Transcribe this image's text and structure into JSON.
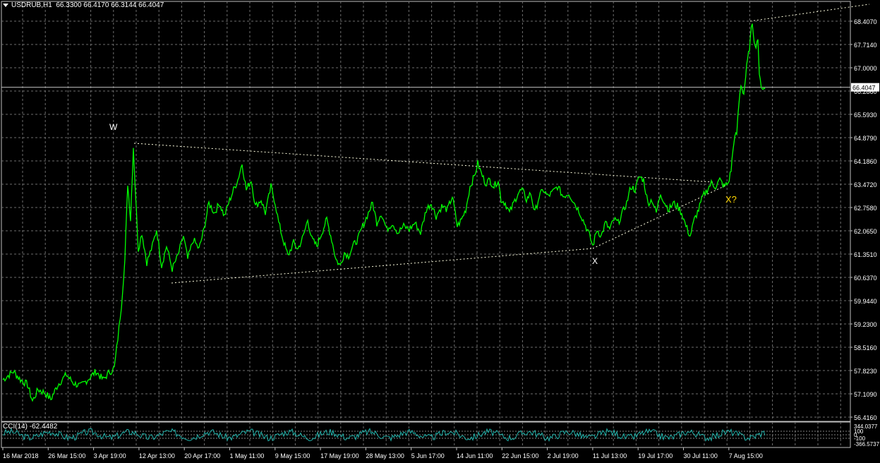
{
  "window": {
    "symbol": "USDRUB,H1",
    "ohlc": "66.3300 66.4170 66.3144 66.4047"
  },
  "colors": {
    "background": "#000000",
    "grid": "#6e6e6e",
    "price_line": "#00ff00",
    "bid_line": "#c0c0c0",
    "wave_lines": "#ffffe0",
    "cci_line": "#20b2aa",
    "text": "#ffffff",
    "label_x_question": "#ffd700"
  },
  "price_axis": {
    "ticks": [
      "68.4070",
      "67.7140",
      "67.0000",
      "66.2860",
      "65.5930",
      "64.8790",
      "64.1860",
      "63.4720",
      "62.7580",
      "62.0650",
      "61.3510",
      "60.6370",
      "59.9440",
      "59.2300",
      "58.5160",
      "57.8230",
      "57.1090",
      "56.4160"
    ],
    "current_price": "66.4047"
  },
  "cci_axis": {
    "ticks": [
      "344.0377",
      "100",
      "0",
      "-100",
      "-366.5737"
    ]
  },
  "cci": {
    "label": "CCI(14) -62.4482"
  },
  "time_axis": {
    "labels": [
      "16 Mar 2018",
      "26 Mar 15:00",
      "3 Apr 19:00",
      "12 Apr 13:00",
      "20 Apr 17:00",
      "1 May 11:00",
      "9 May 15:00",
      "17 May 19:00",
      "28 May 13:00",
      "5 Jun 17:00",
      "14 Jun 11:00",
      "22 Jun 15:00",
      "2 Jul 19:00",
      "11 Jul 13:00",
      "19 Jul 17:00",
      "30 Jul 11:00",
      "7 Aug 15:00"
    ]
  },
  "annotations": {
    "w": "W",
    "x": "X",
    "x_question": "X?"
  },
  "chart_data": {
    "type": "line",
    "title": "USDRUB,H1",
    "ylim": [
      56.416,
      68.407
    ],
    "series": [
      {
        "name": "USDRUB,H1",
        "points": [
          [
            0,
            57.55
          ],
          [
            15,
            57.8
          ],
          [
            25,
            57.55
          ],
          [
            35,
            57.4
          ],
          [
            42,
            56.9
          ],
          [
            50,
            57.25
          ],
          [
            60,
            57.15
          ],
          [
            68,
            56.95
          ],
          [
            78,
            57.4
          ],
          [
            90,
            57.7
          ],
          [
            100,
            57.45
          ],
          [
            110,
            57.35
          ],
          [
            120,
            57.55
          ],
          [
            132,
            57.8
          ],
          [
            142,
            57.55
          ],
          [
            150,
            57.75
          ],
          [
            158,
            57.9
          ],
          [
            163,
            58.8
          ],
          [
            168,
            59.8
          ],
          [
            173,
            61.2
          ],
          [
            177,
            63.5
          ],
          [
            181,
            62.4
          ],
          [
            185,
            64.6
          ],
          [
            188,
            63.2
          ],
          [
            192,
            61.5
          ],
          [
            197,
            62.0
          ],
          [
            204,
            61.1
          ],
          [
            212,
            61.6
          ],
          [
            218,
            62.1
          ],
          [
            225,
            61.0
          ],
          [
            232,
            61.6
          ],
          [
            240,
            60.9
          ],
          [
            248,
            61.3
          ],
          [
            256,
            61.9
          ],
          [
            262,
            61.2
          ],
          [
            270,
            61.8
          ],
          [
            278,
            61.5
          ],
          [
            285,
            62.1
          ],
          [
            292,
            62.9
          ],
          [
            300,
            62.6
          ],
          [
            307,
            62.9
          ],
          [
            314,
            62.5
          ],
          [
            320,
            62.9
          ],
          [
            327,
            63.3
          ],
          [
            333,
            63.6
          ],
          [
            339,
            64.1
          ],
          [
            345,
            63.3
          ],
          [
            352,
            63.6
          ],
          [
            358,
            62.8
          ],
          [
            366,
            63.0
          ],
          [
            372,
            62.6
          ],
          [
            380,
            63.4
          ],
          [
            386,
            62.9
          ],
          [
            391,
            62.3
          ],
          [
            397,
            61.8
          ],
          [
            404,
            61.3
          ],
          [
            412,
            61.7
          ],
          [
            418,
            61.5
          ],
          [
            426,
            61.9
          ],
          [
            432,
            62.4
          ],
          [
            438,
            61.8
          ],
          [
            445,
            61.6
          ],
          [
            452,
            62.0
          ],
          [
            459,
            62.4
          ],
          [
            466,
            61.8
          ],
          [
            472,
            61.2
          ],
          [
            478,
            61.0
          ],
          [
            484,
            61.4
          ],
          [
            490,
            61.3
          ],
          [
            496,
            61.6
          ],
          [
            503,
            61.8
          ],
          [
            510,
            62.2
          ],
          [
            518,
            62.6
          ],
          [
            524,
            62.9
          ],
          [
            530,
            62.3
          ],
          [
            536,
            62.6
          ],
          [
            544,
            62.1
          ],
          [
            552,
            62.3
          ],
          [
            560,
            62.0
          ],
          [
            568,
            62.2
          ],
          [
            576,
            62.1
          ],
          [
            584,
            62.3
          ],
          [
            592,
            62.0
          ],
          [
            600,
            62.7
          ],
          [
            607,
            62.9
          ],
          [
            614,
            62.5
          ],
          [
            622,
            62.8
          ],
          [
            630,
            62.7
          ],
          [
            637,
            63.1
          ],
          [
            644,
            62.2
          ],
          [
            650,
            62.4
          ],
          [
            656,
            62.7
          ],
          [
            662,
            63.4
          ],
          [
            668,
            63.7
          ],
          [
            673,
            64.1
          ],
          [
            678,
            63.8
          ],
          [
            684,
            63.5
          ],
          [
            690,
            63.6
          ],
          [
            696,
            63.4
          ],
          [
            702,
            63.6
          ],
          [
            706,
            63.0
          ],
          [
            712,
            62.9
          ],
          [
            718,
            62.6
          ],
          [
            724,
            62.9
          ],
          [
            730,
            63.2
          ],
          [
            736,
            63.3
          ],
          [
            742,
            63.0
          ],
          [
            748,
            63.2
          ],
          [
            754,
            62.6
          ],
          [
            760,
            63.1
          ],
          [
            766,
            63.3
          ],
          [
            772,
            63.1
          ],
          [
            778,
            63.2
          ],
          [
            786,
            63.4
          ],
          [
            794,
            63.1
          ],
          [
            802,
            63.2
          ],
          [
            810,
            62.9
          ],
          [
            818,
            62.6
          ],
          [
            824,
            62.3
          ],
          [
            830,
            62.0
          ],
          [
            836,
            61.6
          ],
          [
            842,
            62.1
          ],
          [
            848,
            61.9
          ],
          [
            854,
            62.3
          ],
          [
            860,
            62.1
          ],
          [
            866,
            62.4
          ],
          [
            872,
            62.3
          ],
          [
            878,
            62.6
          ],
          [
            884,
            62.9
          ],
          [
            890,
            63.4
          ],
          [
            896,
            63.3
          ],
          [
            902,
            63.7
          ],
          [
            908,
            63.6
          ],
          [
            914,
            62.9
          ],
          [
            920,
            63.0
          ],
          [
            926,
            62.6
          ],
          [
            932,
            63.2
          ],
          [
            938,
            62.9
          ],
          [
            944,
            62.7
          ],
          [
            950,
            62.9
          ],
          [
            956,
            62.8
          ],
          [
            962,
            62.6
          ],
          [
            968,
            62.2
          ],
          [
            974,
            61.9
          ],
          [
            980,
            62.4
          ],
          [
            986,
            62.7
          ],
          [
            992,
            63.1
          ],
          [
            998,
            63.3
          ],
          [
            1004,
            63.5
          ],
          [
            1010,
            63.4
          ],
          [
            1016,
            63.6
          ],
          [
            1022,
            63.4
          ],
          [
            1028,
            63.5
          ],
          [
            1032,
            63.9
          ],
          [
            1036,
            64.8
          ],
          [
            1040,
            65.0
          ],
          [
            1043,
            65.9
          ],
          [
            1046,
            66.5
          ],
          [
            1050,
            66.2
          ],
          [
            1054,
            67.0
          ],
          [
            1058,
            67.6
          ],
          [
            1062,
            68.4
          ],
          [
            1066,
            67.6
          ],
          [
            1070,
            67.9
          ],
          [
            1072,
            66.7
          ],
          [
            1076,
            66.4
          ],
          [
            1080,
            66.35
          ]
        ]
      },
      {
        "name": "CCI(14)",
        "values_range": [
          -366.5737,
          344.0377
        ],
        "last_value": -62.4482
      }
    ]
  }
}
